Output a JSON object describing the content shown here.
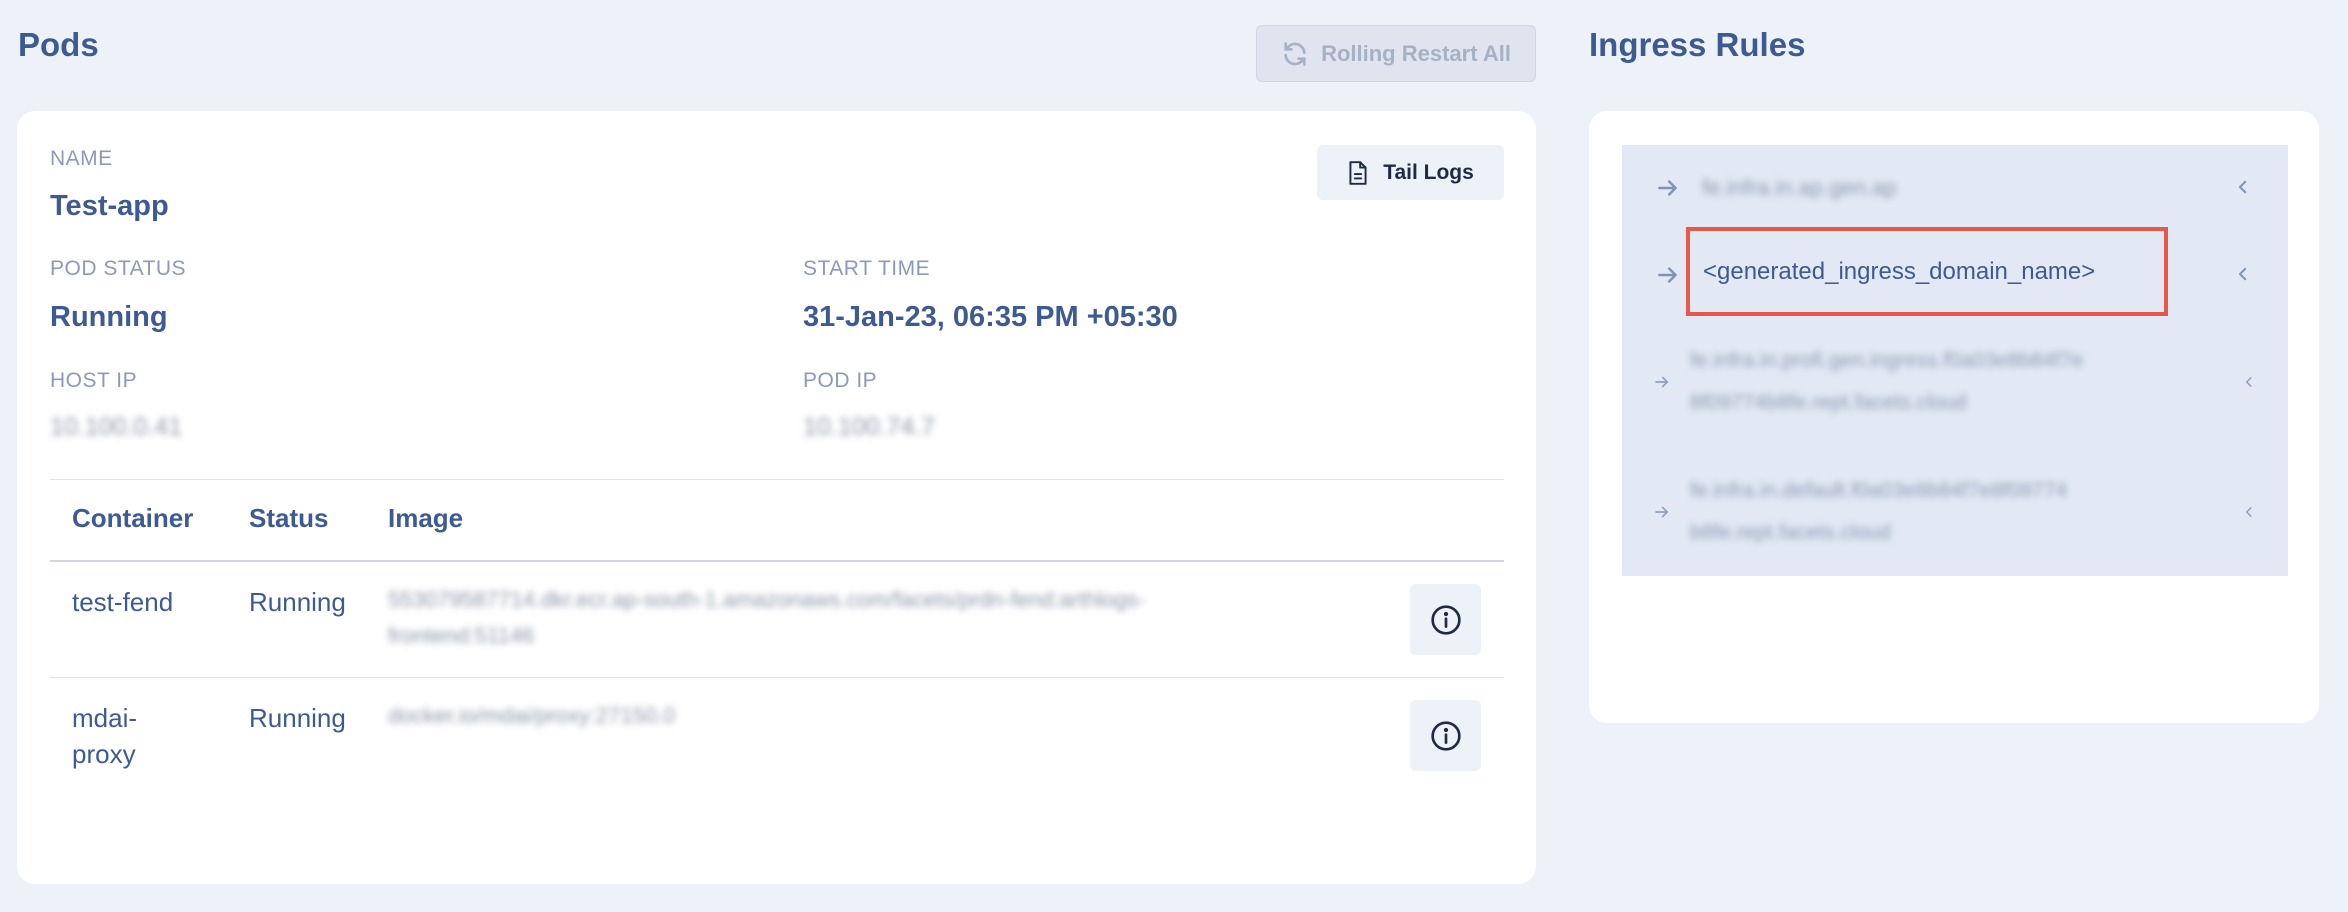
{
  "pods": {
    "title": "Pods",
    "restart_label": "Rolling Restart All",
    "tail_logs_label": "Tail Logs",
    "name_label": "NAME",
    "name_value": "Test-app",
    "status_label": "POD STATUS",
    "status_value": "Running",
    "start_label": "START TIME",
    "start_value": "31-Jan-23, 06:35 PM +05:30",
    "host_ip_label": "HOST IP",
    "host_ip_value": "10.100.0.41",
    "pod_ip_label": "POD IP",
    "pod_ip_value": "10.100.74.7",
    "table": {
      "headers": [
        "Container",
        "Status",
        "Image"
      ],
      "rows": [
        {
          "container": "test-fend",
          "status": "Running",
          "image_line1": "553079587714.dkr.ecr.ap-south-1.amazonaws.com/facets/prdn-fend:arthlogs-",
          "image_line2": "frontend:51146"
        },
        {
          "container_line1": "mdai-",
          "container_line2": "proxy",
          "status": "Running",
          "image_line1": "docker.io/mdai/proxy:27150.0"
        }
      ]
    }
  },
  "ingress": {
    "title": "Ingress Rules",
    "items": [
      {
        "line1": "fe.infra.in.ap.gen.ap"
      },
      {
        "line1": "<generated_ingress_domain_name>"
      },
      {
        "line1": "fe.infra.in.profi.gen.ingress.f0a03e8b84f7e",
        "line2": "8f09774b8fe.rept.facets.cloud"
      },
      {
        "line1": "fe.infra.in.default.f0a03e8b84f7e8f09774",
        "line2": "b8fe.rept.facets.cloud"
      }
    ]
  },
  "colors": {
    "accent": "#3e5a92",
    "highlight_border": "#e8574a",
    "background": "#edf1f8"
  },
  "icons": [
    "refresh-icon",
    "document-icon",
    "info-icon",
    "arrow-right-icon",
    "chevron-left-icon"
  ]
}
